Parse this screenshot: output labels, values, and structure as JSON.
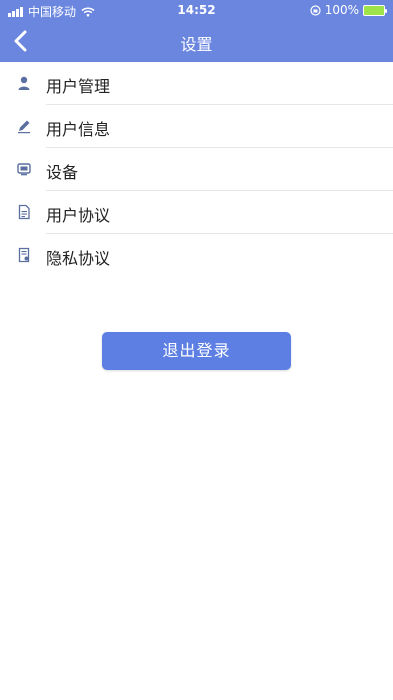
{
  "status_bar": {
    "carrier": "中国移动",
    "time": "14:52",
    "battery": "100%"
  },
  "nav": {
    "title": "设置"
  },
  "menu": [
    {
      "label": "用户管理",
      "icon": "user-icon"
    },
    {
      "label": "用户信息",
      "icon": "pencil-icon"
    },
    {
      "label": "设备",
      "icon": "device-icon"
    },
    {
      "label": "用户协议",
      "icon": "document-icon"
    },
    {
      "label": "隐私协议",
      "icon": "privacy-document-icon"
    }
  ],
  "logout_label": "退出登录",
  "colors": {
    "header": "#6b86df",
    "button": "#5d7fe3",
    "icon": "#5a6f9f"
  }
}
